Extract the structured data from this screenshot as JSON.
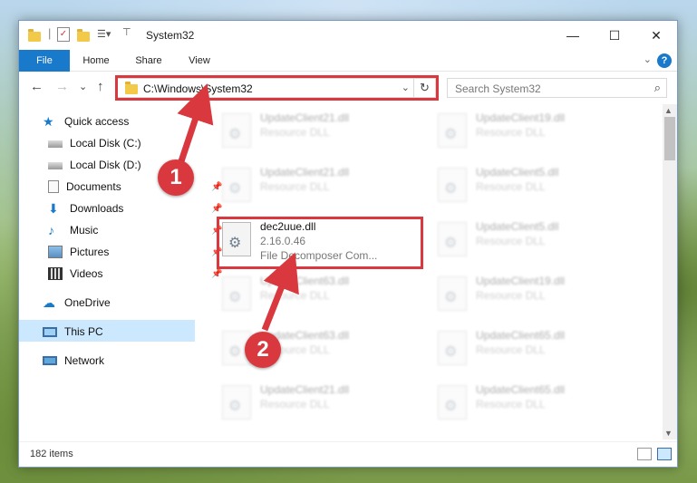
{
  "window": {
    "title": "System32",
    "minimize": "—",
    "maximize": "☐",
    "close": "✕"
  },
  "ribbon": {
    "tabs": [
      "File",
      "Home",
      "Share",
      "View"
    ],
    "help": "?",
    "collapse": "⌄"
  },
  "nav": {
    "back": "←",
    "forward": "→",
    "recent": "⌄",
    "up": "↑",
    "address": "C:\\Windows\\System32",
    "address_dropdown": "⌄",
    "refresh": "↻",
    "search_placeholder": "Search System32",
    "search_icon": "⌕"
  },
  "sidebar": {
    "items": [
      {
        "label": "Quick access",
        "icon": "star-icon"
      },
      {
        "label": "Local Disk (C:)",
        "icon": "drive-icon"
      },
      {
        "label": "Local Disk (D:)",
        "icon": "drive-icon"
      },
      {
        "label": "Documents",
        "icon": "documents-icon"
      },
      {
        "label": "Downloads",
        "icon": "downloads-icon"
      },
      {
        "label": "Music",
        "icon": "music-icon"
      },
      {
        "label": "Pictures",
        "icon": "pictures-icon"
      },
      {
        "label": "Videos",
        "icon": "videos-icon"
      },
      {
        "label": "OneDrive",
        "icon": "cloud-icon"
      },
      {
        "label": "This PC",
        "icon": "pc-icon"
      },
      {
        "label": "Network",
        "icon": "network-icon"
      }
    ],
    "pin_glyph": "📌"
  },
  "files": [
    {
      "name": "UpdateClient21.dll",
      "line1": "Resource DLL"
    },
    {
      "name": "UpdateClient19.dll",
      "line1": "Resource DLL"
    },
    {
      "name": "UpdateClient21.dll",
      "line1": "Resource DLL"
    },
    {
      "name": "UpdateClient5.dll",
      "line1": "Resource DLL"
    },
    {
      "name": "dec2uue.dll",
      "line1": "2.16.0.46",
      "line2": "File Decomposer Com..."
    },
    {
      "name": "UpdateClient5.dll",
      "line1": "Resource DLL"
    },
    {
      "name": "UpdateClient63.dll",
      "line1": "Resource DLL"
    },
    {
      "name": "UpdateClient19.dll",
      "line1": "Resource DLL"
    },
    {
      "name": "UpdateClient63.dll",
      "line1": "Resource DLL"
    },
    {
      "name": "UpdateClient65.dll",
      "line1": "Resource DLL"
    },
    {
      "name": "UpdateClient21.dll",
      "line1": "Resource DLL"
    },
    {
      "name": "UpdateClient65.dll",
      "line1": "Resource DLL"
    }
  ],
  "status": {
    "items": "182 items"
  },
  "callouts": [
    "1",
    "2"
  ],
  "colors": {
    "accent": "#1979ca",
    "highlight": "#d9393e",
    "selected": "#cce8ff"
  }
}
